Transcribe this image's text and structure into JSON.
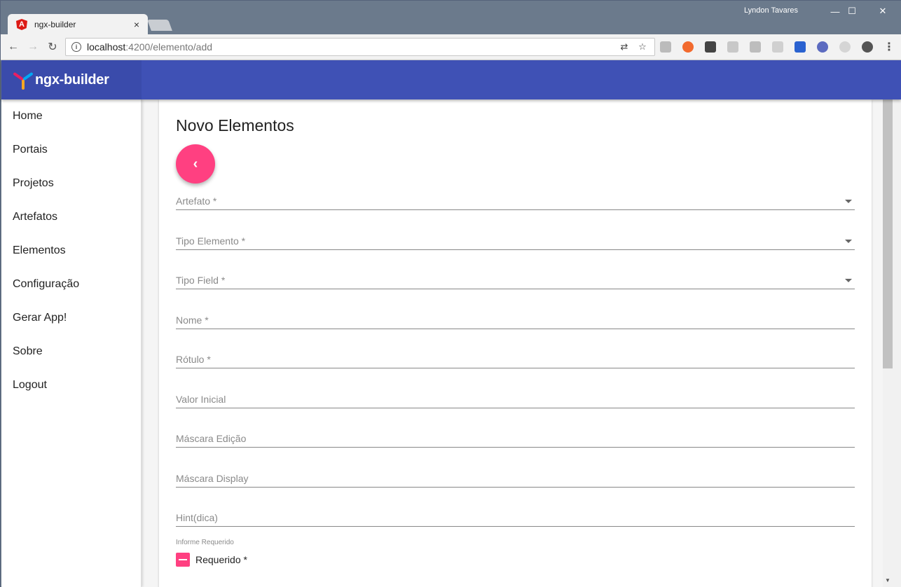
{
  "browser": {
    "tab_title": "ngx-builder",
    "tab_close": "×",
    "favicon_letter": "A",
    "profile_name": "Lyndon Tavares",
    "url_host": "localhost",
    "url_path": ":4200/elemento/add",
    "window_controls": {
      "minimize": "—",
      "maximize": "☐",
      "close": "✕"
    },
    "nav": {
      "back": "←",
      "forward": "→",
      "reload": "↻"
    },
    "omni_icons": {
      "translate": "🌐",
      "star": "☆"
    }
  },
  "app": {
    "brand": "ngx-builder",
    "colors": {
      "primary": "#3f51b5",
      "accent": "#ff4081"
    }
  },
  "sidenav": {
    "items": [
      {
        "label": "Home"
      },
      {
        "label": "Portais"
      },
      {
        "label": "Projetos"
      },
      {
        "label": "Artefatos"
      },
      {
        "label": "Elementos"
      },
      {
        "label": "Configuração"
      },
      {
        "label": "Gerar App!"
      },
      {
        "label": "Sobre"
      },
      {
        "label": "Logout"
      }
    ]
  },
  "form": {
    "title": "Novo Elementos",
    "back_button_icon": "‹",
    "fields": [
      {
        "label": "Artefato *",
        "type": "select"
      },
      {
        "label": "Tipo Elemento *",
        "type": "select"
      },
      {
        "label": "Tipo Field *",
        "type": "select"
      },
      {
        "label": "Nome *",
        "type": "input"
      },
      {
        "label": "Rótulo *",
        "type": "input"
      },
      {
        "label": "Valor Inicial",
        "type": "input"
      },
      {
        "label": "Máscara Edição",
        "type": "input"
      },
      {
        "label": "Máscara Display",
        "type": "input"
      },
      {
        "label": "Hint(dica)",
        "type": "input"
      }
    ],
    "required_hint": "Informe Requerido",
    "required_checkbox_label": "Requerido *",
    "required_state": "indeterminate"
  }
}
